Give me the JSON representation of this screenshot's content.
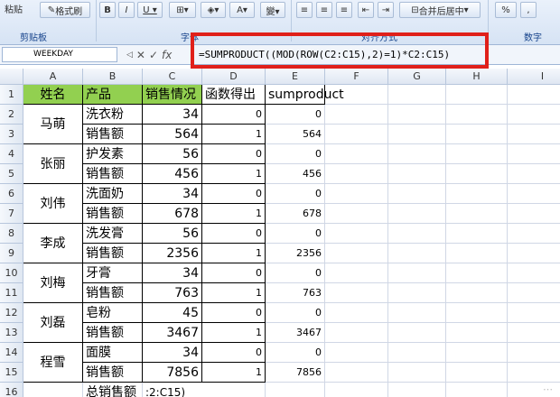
{
  "ribbon": {
    "paste_label": "粘贴",
    "format_painter_label": "格式刷",
    "clipboard_label": "剪贴板",
    "font_label": "字体",
    "alignment_label": "对齐方式",
    "merge_center_label": "合并后居中",
    "number_label": "数字",
    "percent_label": "%",
    "comma_label": ","
  },
  "formula_bar": {
    "name_box": "WEEKDAY",
    "formula": "=SUMPRODUCT((MOD(ROW(C2:C15),2)=1)*C2:C15)"
  },
  "columns": [
    "A",
    "B",
    "C",
    "D",
    "E",
    "F",
    "G",
    "H",
    "I"
  ],
  "rows": [
    "1",
    "2",
    "3",
    "4",
    "5",
    "6",
    "7",
    "8",
    "9",
    "10",
    "11",
    "12",
    "13",
    "14",
    "15",
    "16"
  ],
  "header": {
    "a": "姓名",
    "b": "产品",
    "c": "销售情况",
    "d": "函数得出",
    "e": "sumproduct"
  },
  "people": [
    "马萌",
    "张丽",
    "刘伟",
    "李成",
    "刘梅",
    "刘磊",
    "程雪"
  ],
  "products": [
    "洗衣粉",
    "销售额",
    "护发素",
    "销售额",
    "洗面奶",
    "销售额",
    "洗发膏",
    "销售额",
    "牙膏",
    "销售额",
    "皂粉",
    "销售额",
    "面膜",
    "销售额"
  ],
  "c_values": [
    "34",
    "564",
    "56",
    "456",
    "34",
    "678",
    "56",
    "2356",
    "34",
    "763",
    "45",
    "3467",
    "34",
    "7856"
  ],
  "d_values": [
    "0",
    "1",
    "0",
    "1",
    "0",
    "1",
    "0",
    "1",
    "0",
    "1",
    "0",
    "1",
    "0",
    "1"
  ],
  "e_values": [
    "0",
    "564",
    "0",
    "456",
    "0",
    "678",
    "0",
    "2356",
    "0",
    "763",
    "0",
    "3467",
    "0",
    "7856"
  ],
  "total_label": "总销售额",
  "total_edit": ":2:C15)"
}
